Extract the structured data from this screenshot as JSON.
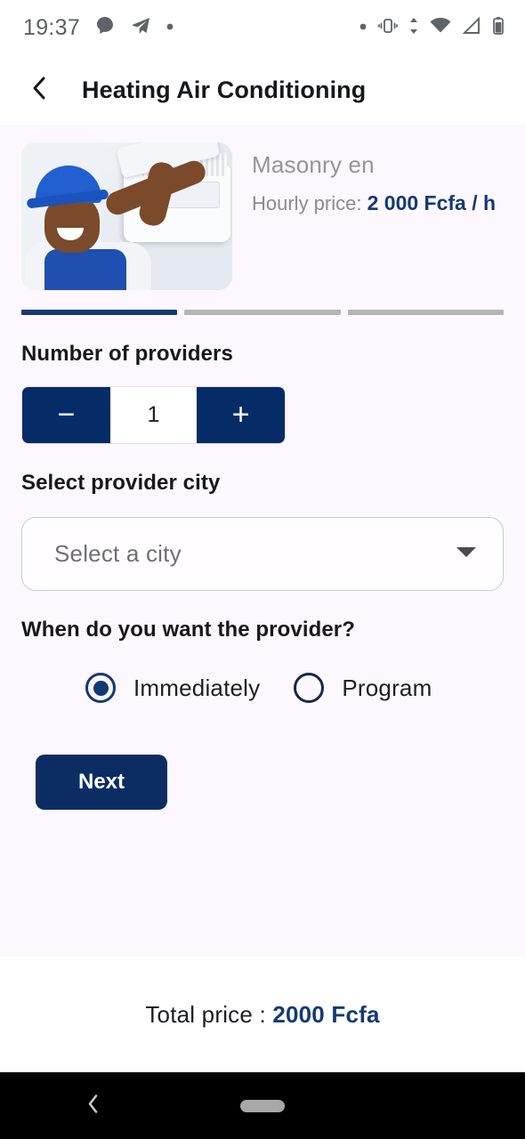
{
  "status_bar": {
    "time": "19:37",
    "left_icons": [
      "chat-bubble-icon",
      "telegram-send-icon",
      "dot-icon"
    ],
    "right_icons": [
      "dot-icon",
      "vibrate-icon",
      "data-transfer-icon",
      "wifi-icon",
      "signal-icon",
      "battery-icon"
    ],
    "wifi_badge": "4"
  },
  "header": {
    "back_label": "Back",
    "title": "Heating Air Conditioning"
  },
  "service": {
    "image_alt": "technician-installing-air-conditioner",
    "name": "Masonry en",
    "price_label": "Hourly price:",
    "price_value": "2 000 Fcfa / h"
  },
  "progress": {
    "steps": [
      {
        "label": "step-1",
        "active": true
      },
      {
        "label": "step-2",
        "active": false
      },
      {
        "label": "step-3",
        "active": false
      }
    ]
  },
  "providers": {
    "label": "Number of providers",
    "decrement_label": "−",
    "value": "1",
    "increment_label": "+"
  },
  "city": {
    "label": "Select provider city",
    "placeholder": "Select a city",
    "value": "Select a city",
    "chevron": "chevron-down-icon"
  },
  "timing": {
    "question": "When do you want the provider?",
    "options": [
      {
        "label": "Immediately",
        "selected": true
      },
      {
        "label": "Program",
        "selected": false
      }
    ]
  },
  "actions": {
    "next_label": "Next"
  },
  "footer": {
    "total_label": "Total price : ",
    "total_value": "2000 Fcfa"
  },
  "nav_bar": {
    "back": "nav-back-icon",
    "home": "nav-home-pill"
  },
  "colors": {
    "navy": "#052c66",
    "accent_navy": "#123a75",
    "content_bg": "#fdf7ff",
    "muted_text": "#9b9199"
  }
}
